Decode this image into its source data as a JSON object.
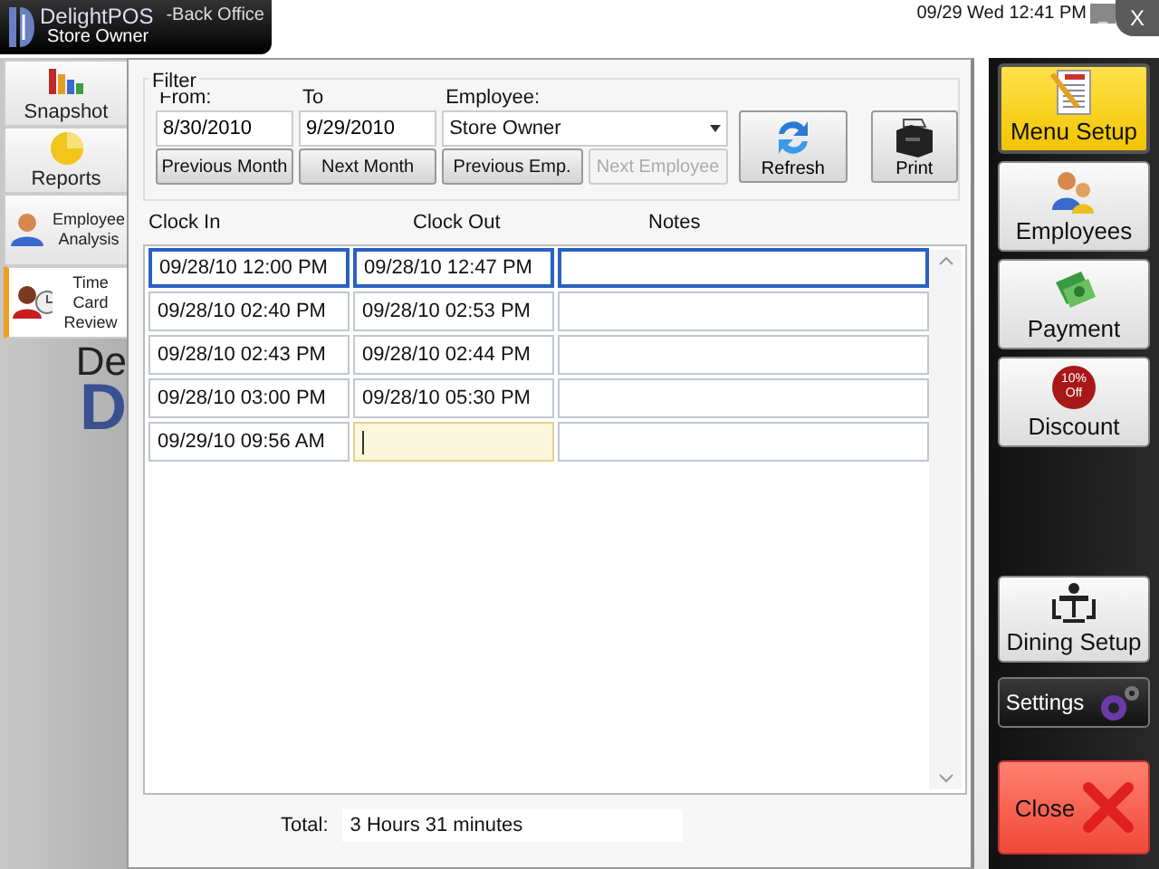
{
  "header": {
    "brand": "DelightPOS",
    "user": "Store Owner",
    "section": "-Back Office",
    "datetime": "09/29 Wed 12:41 PM",
    "minimize": "_",
    "close": "X"
  },
  "sidebar": {
    "items": [
      {
        "label": "Snapshot",
        "selected": false
      },
      {
        "label": "Reports",
        "selected": false
      },
      {
        "label": "Employee Analysis",
        "selected": false
      },
      {
        "label": "Time Card Review",
        "selected": true
      }
    ],
    "logo_fragments": [
      "De",
      "D"
    ]
  },
  "filter": {
    "title": "Filter",
    "from_label": "From:",
    "from": "8/30/2010",
    "to_label": "To",
    "to": "9/29/2010",
    "employee_label": "Employee:",
    "employee": "Store Owner",
    "buttons": [
      {
        "label": "Previous Month",
        "disabled": false
      },
      {
        "label": "Next Month",
        "disabled": false
      },
      {
        "label": "Previous Emp.",
        "disabled": false
      },
      {
        "label": "Next Employee",
        "disabled": true
      }
    ],
    "refresh": "Refresh",
    "print": "Print"
  },
  "table": {
    "columns": [
      "Clock In",
      "Clock Out",
      "Notes"
    ],
    "rows": [
      {
        "clock_in": "09/28/10 12:00 PM",
        "clock_out": "09/28/10 12:47 PM",
        "selected": true,
        "editing": false
      },
      {
        "clock_in": "09/28/10 02:40 PM",
        "clock_out": "09/28/10 02:53 PM",
        "selected": false,
        "editing": false
      },
      {
        "clock_in": "09/28/10 02:43 PM",
        "clock_out": "09/28/10 02:44 PM",
        "selected": false,
        "editing": false
      },
      {
        "clock_in": "09/28/10 03:00 PM",
        "clock_out": "09/28/10 05:30 PM",
        "selected": false,
        "editing": false
      },
      {
        "clock_in": "09/29/10 09:56 AM",
        "selected": false,
        "editing": true
      }
    ]
  },
  "total": {
    "label": "Total:",
    "value": "3 Hours 31 minutes"
  },
  "actions": [
    {
      "label": "Menu Setup",
      "kind": "menu",
      "selected": true
    },
    {
      "label": "Employees",
      "kind": "people",
      "selected": false
    },
    {
      "label": "Payment",
      "kind": "money",
      "selected": false
    },
    {
      "label": "Discount",
      "kind": "discount",
      "badge": [
        "10%",
        "Off"
      ],
      "selected": false
    },
    {
      "label": "Dining Setup",
      "kind": "dining",
      "selected": false
    },
    {
      "label": "Settings",
      "kind": "settings",
      "selected": false
    },
    {
      "label": "Close",
      "kind": "close",
      "selected": false
    }
  ]
}
